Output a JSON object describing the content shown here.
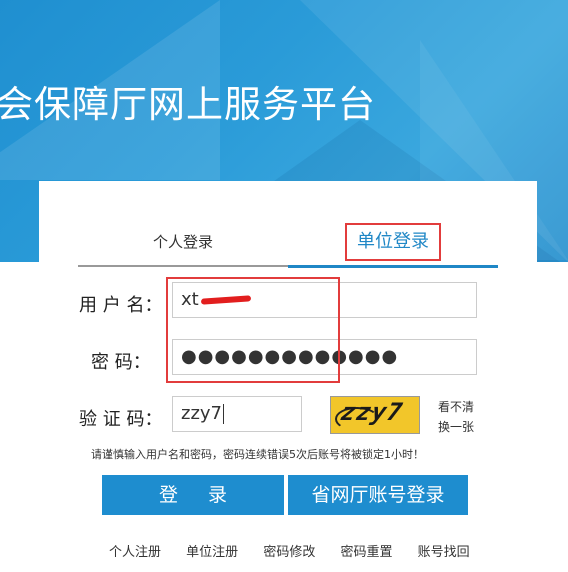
{
  "banner": {
    "title": "会保障厅网上服务平台"
  },
  "tabs": {
    "personal": "个人登录",
    "unit": "单位登录"
  },
  "form": {
    "username_label": "用 户 名：",
    "username_value": "xt",
    "password_label": "密    码：",
    "password_value": "●●●●●●●●●●●●●",
    "captcha_label": "验 证 码：",
    "captcha_value": "zzy7",
    "captcha_image_text": "zzy7",
    "refresh_line1": "看不清",
    "refresh_line2": "换一张"
  },
  "notice": "请谨慎输入用户名和密码，密码连续错误5次后账号将被锁定1小时！",
  "buttons": {
    "login": "登  录",
    "provincial": "省网厅账号登录"
  },
  "links": [
    "个人注册",
    "单位注册",
    "密码修改",
    "密码重置",
    "账号找回"
  ],
  "colors": {
    "brand_blue": "#1e8dcf",
    "highlight_red": "#e23c3c",
    "captcha_bg": "#f2c62a"
  }
}
